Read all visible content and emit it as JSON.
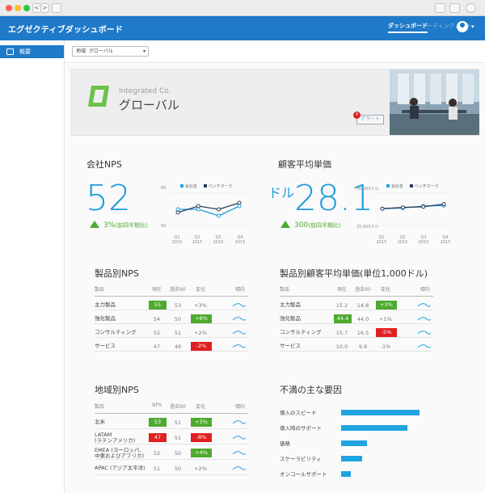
{
  "browser": {
    "nav_back": "<",
    "nav_forward": ">"
  },
  "app": {
    "title": "エグゼクティブダッシュボード",
    "tabs": [
      {
        "label": "ダッシュボード",
        "active": true
      },
      {
        "label": "ミーティングノート",
        "active": false
      }
    ]
  },
  "sidebar": {
    "items": [
      {
        "label": "概要",
        "icon": "overview-icon"
      }
    ]
  },
  "filter": {
    "value": "地域: グローバル"
  },
  "banner": {
    "company": "Integrated Co.",
    "region": "グローバル",
    "alert_label": "アラート",
    "alert_count": "4"
  },
  "nps": {
    "title": "会社NPS",
    "value": "52",
    "trend": "3%",
    "trend_note": "(前四半期比)",
    "chart": {
      "legend": [
        "会社名",
        "ベンチマーク"
      ],
      "y_ticks": [
        "60",
        "50"
      ],
      "quarters": [
        "Q1\n2015",
        "Q2\n2015",
        "Q3\n2015",
        "Q4\n2015"
      ]
    }
  },
  "price": {
    "title": "顧客平均単価",
    "unit": "ドル",
    "value": "28.1",
    "trend": "300",
    "trend_note": "(前四半期比)",
    "chart": {
      "legend": [
        "会社名",
        "ベンチマーク"
      ],
      "y_ticks": [
        "30,000ドル",
        "25,000ドル"
      ],
      "quarters": [
        "Q1\n2015",
        "Q2\n2015",
        "Q3\n2015",
        "Q4\n2015"
      ]
    }
  },
  "nps_product": {
    "title": "製品別NPS",
    "headers": [
      "製品",
      "現在",
      "過去90",
      "変化",
      "傾向"
    ],
    "rows": [
      {
        "name": "主力製品",
        "current": "55",
        "past": "53",
        "change": "+3%",
        "current_style": "green",
        "change_style": "none"
      },
      {
        "name": "強化製品",
        "current": "54",
        "past": "50",
        "change": "+8%",
        "current_style": "none",
        "change_style": "green"
      },
      {
        "name": "コンサルティング",
        "current": "52",
        "past": "51",
        "change": "+2%",
        "current_style": "none",
        "change_style": "none"
      },
      {
        "name": "サービス",
        "current": "47",
        "past": "46",
        "change": "-2%",
        "current_style": "none",
        "change_style": "red"
      }
    ]
  },
  "price_product": {
    "title": "製品別顧客平均単価(単位1,000ドル)",
    "headers": [
      "製品",
      "現在",
      "過去90",
      "変化",
      "傾向"
    ],
    "rows": [
      {
        "name": "主力製品",
        "current": "15.2",
        "past": "14.8",
        "change": "+3%",
        "current_style": "none",
        "change_style": "green"
      },
      {
        "name": "強化製品",
        "current": "44.4",
        "past": "44.0",
        "change": "+1%",
        "current_style": "green",
        "change_style": "none"
      },
      {
        "name": "コンサルティング",
        "current": "15.7",
        "past": "16.5",
        "change": "-5%",
        "current_style": "none",
        "change_style": "red"
      },
      {
        "name": "サービス",
        "current": "10.0",
        "past": "9.9",
        "change": "-1%",
        "current_style": "none",
        "change_style": "none"
      }
    ]
  },
  "nps_region": {
    "title": "地域別NPS",
    "headers": [
      "製品",
      "NPS",
      "過去90",
      "変化",
      "傾向"
    ],
    "rows": [
      {
        "name": "北米",
        "current": "53",
        "past": "51",
        "change": "+3%",
        "current_style": "green",
        "change_style": "green"
      },
      {
        "name": "LATAM\n(ラテンアメリカ)",
        "current": "47",
        "past": "51",
        "change": "-8%",
        "current_style": "red",
        "change_style": "red"
      },
      {
        "name": "EMEA (ヨーロッパ、\n中東およびアフリカ)",
        "current": "52",
        "past": "50",
        "change": "+4%",
        "current_style": "none",
        "change_style": "green"
      },
      {
        "name": "APAC (アジア太平洋)",
        "current": "51",
        "past": "50",
        "change": "+2%",
        "current_style": "none",
        "change_style": "none"
      }
    ]
  },
  "complaints": {
    "title": "不満の主な要因",
    "items": [
      {
        "label": "導入のスピード",
        "value": 100
      },
      {
        "label": "導入時のサポート",
        "value": 85
      },
      {
        "label": "価格",
        "value": 33
      },
      {
        "label": "スケーラビリティ",
        "value": 27
      },
      {
        "label": "オンコールサポート",
        "value": 12
      }
    ]
  },
  "chart_data": [
    {
      "type": "line",
      "categories": [
        "Q1 2015",
        "Q2 2015",
        "Q3 2015",
        "Q4 2015"
      ],
      "series": [
        {
          "name": "会社名",
          "values": [
            55,
            55,
            53,
            56
          ]
        },
        {
          "name": "ベンチマーク",
          "values": [
            54,
            56,
            55,
            57
          ]
        }
      ],
      "ylim": [
        50,
        60
      ]
    },
    {
      "type": "line",
      "categories": [
        "Q1 2015",
        "Q2 2015",
        "Q3 2015",
        "Q4 2015"
      ],
      "series": [
        {
          "name": "会社名",
          "values": [
            27600,
            27700,
            28000,
            28100
          ]
        },
        {
          "name": "ベンチマーク",
          "values": [
            27600,
            27800,
            27900,
            28300
          ]
        }
      ],
      "ylim": [
        25000,
        30000
      ]
    }
  ],
  "colors": {
    "accent": "#1f7ac9",
    "highlight": "#1f9cdc",
    "good": "#4eaa2e",
    "bad": "#e02020",
    "bench": "#2a3e5a"
  }
}
